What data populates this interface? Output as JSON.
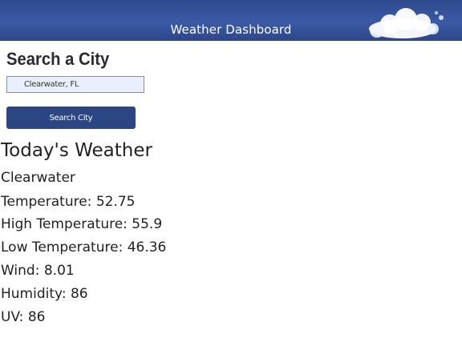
{
  "header": {
    "title": "Weather Dashboard",
    "background_color": "#34509a"
  },
  "search": {
    "heading": "Search a City",
    "input_value": "Clearwater, FL",
    "button_label": "Search City",
    "button_color": "#2b4683"
  },
  "weather": {
    "heading": "Today's Weather",
    "city": "Clearwater",
    "temperature": "Temperature: 52.75",
    "high_temperature": "High Temperature: 55.9",
    "low_temperature": "Low Temperature: 46.36",
    "wind": "Wind: 8.01",
    "humidity": "Humidity: 86",
    "uv": "UV: 86"
  }
}
